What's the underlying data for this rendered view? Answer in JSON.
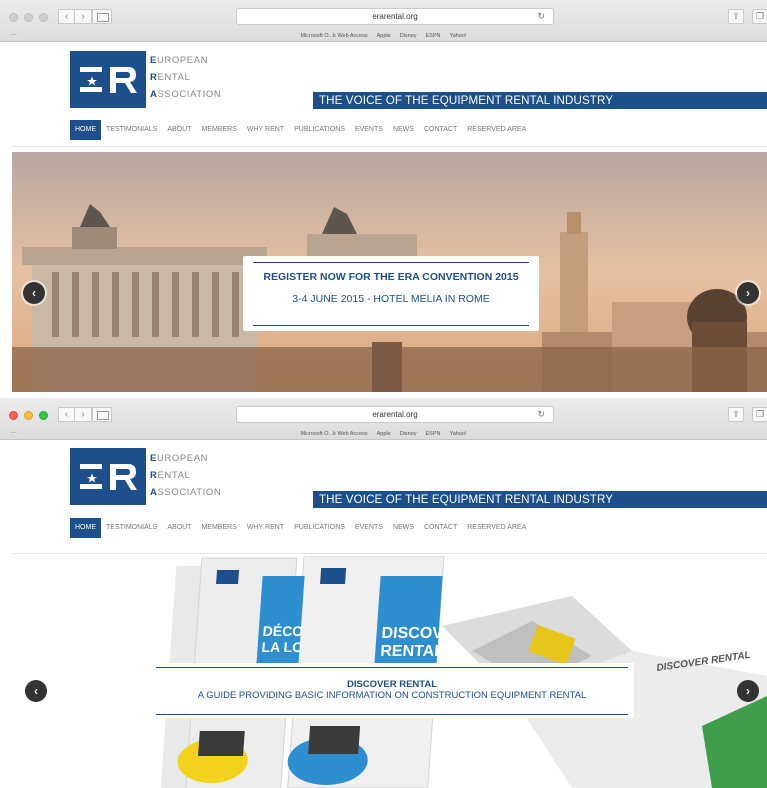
{
  "browser": {
    "url": "erarental.org",
    "favorites": [
      "Microsoft O...k Web Access",
      "Apple",
      "Disney",
      "ESPN",
      "Yahoo!"
    ]
  },
  "logo": {
    "line1_initial": "E",
    "line1_rest": "UROPEAN",
    "line2_initial": "R",
    "line2_rest": "ENTAL",
    "line3_initial": "A",
    "line3_rest": "SSOCIATION"
  },
  "tagline": "THE VOICE OF THE EQUIPMENT RENTAL INDUSTRY",
  "nav": [
    {
      "label": "HOME",
      "active": true
    },
    {
      "label": "TESTIMONIALS"
    },
    {
      "label": "ABOUT"
    },
    {
      "label": "MEMBERS"
    },
    {
      "label": "WHY RENT"
    },
    {
      "label": "PUBLICATIONS"
    },
    {
      "label": "EVENTS"
    },
    {
      "label": "NEWS"
    },
    {
      "label": "CONTACT"
    },
    {
      "label": "RESERVED AREA"
    }
  ],
  "slide1": {
    "title": "REGISTER NOW FOR THE ERA CONVENTION 2015",
    "subtitle": "3-4 JUNE 2015 - HOTEL MELIA IN ROME"
  },
  "slide2": {
    "title": "DISCOVER RENTAL",
    "subtitle": "A GUIDE PROVIDING BASIC INFORMATION ON CONSTRUCTION EQUIPMENT RENTAL",
    "brochure_text": [
      "DISCOVER RENTAL",
      "DISCOVER",
      "RENTAL",
      "DÉCO",
      "LA LO"
    ]
  },
  "colors": {
    "brand_blue": "#1d4f8c"
  }
}
